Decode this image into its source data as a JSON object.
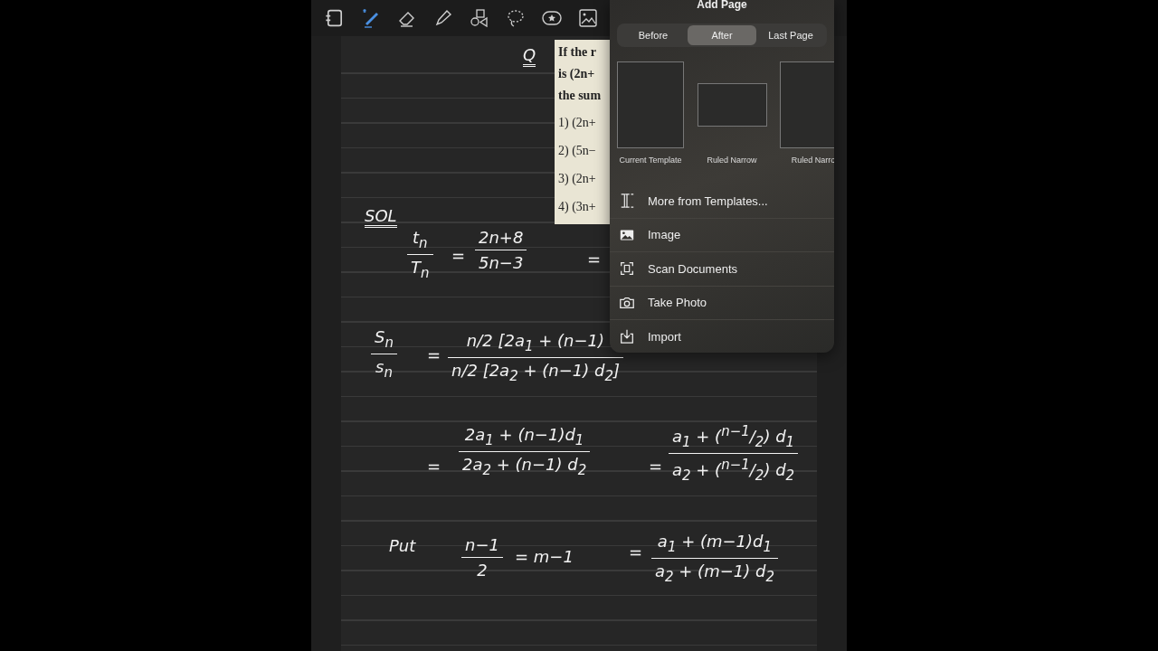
{
  "toolbar": {
    "tools": [
      {
        "kind": "pages",
        "selected": false
      },
      {
        "kind": "pen",
        "selected": true
      },
      {
        "kind": "eraser",
        "selected": false
      },
      {
        "kind": "highlighter",
        "selected": false
      },
      {
        "kind": "shapes",
        "selected": false
      },
      {
        "kind": "lasso",
        "selected": false
      },
      {
        "kind": "sticker",
        "selected": false
      },
      {
        "kind": "image",
        "selected": false
      }
    ]
  },
  "question_image": {
    "lines": [
      "If the r",
      "is (2n+",
      "the sum",
      "1) (2n+",
      "2) (5n−",
      "3) (2n+",
      "4) (3n+"
    ]
  },
  "ink": [
    {
      "kind": "underlined",
      "text": "Q"
    },
    {
      "kind": "underlined",
      "text": "SOL"
    },
    {
      "kind": "fraction",
      "num": "t$_{n}$",
      "den": "T$_{n}$"
    },
    {
      "kind": "label",
      "text": "="
    },
    {
      "kind": "fraction",
      "num": "2n+8",
      "den": "5n−3"
    },
    {
      "kind": "label",
      "text": "="
    },
    {
      "kind": "fraction",
      "num": "S$_{n}$",
      "den": "s$_{n}$"
    },
    {
      "kind": "label",
      "text": "="
    },
    {
      "kind": "fraction",
      "num": "n/2 [2a$_{1}$ + (n−1)",
      "den": "n/2 [2a$_{2}$ + (n−1) d$_{2}$]"
    },
    {
      "kind": "label",
      "text": "="
    },
    {
      "kind": "fraction",
      "num": "2a$_{1}$ + (n−1)d$_{1}$",
      "den": "2a$_{2}$ + (n−1) d$_{2}$"
    },
    {
      "kind": "label",
      "text": "="
    },
    {
      "kind": "fraction",
      "num": "a$_{1}$ + ($^{n−1}$/$_{2}$) d$_{1}$",
      "den": "a$_{2}$ + ($^{n−1}$/$_{2}$) d$_{2}$"
    },
    {
      "kind": "label",
      "text": "Put"
    },
    {
      "kind": "fraction",
      "num": "n−1",
      "den": "2"
    },
    {
      "kind": "label",
      "text": "= m−1"
    },
    {
      "kind": "label",
      "text": "="
    },
    {
      "kind": "fraction",
      "num": "a$_{1}$ + (m−1)d$_{1}$",
      "den": "a$_{2}$ + (m−1) d$_{2}$"
    }
  ],
  "popover": {
    "title": "Add Page",
    "segments": [
      {
        "label": "Before",
        "selected": false
      },
      {
        "label": "After",
        "selected": true
      },
      {
        "label": "Last Page",
        "selected": false
      }
    ],
    "templates": [
      {
        "label": "Current Template",
        "kind": "portrait"
      },
      {
        "label": "Ruled Narrow",
        "kind": "landscape"
      },
      {
        "label": "Ruled Narro",
        "kind": "portrait"
      }
    ],
    "actions": [
      {
        "label": "More from Templates...",
        "kind": "templates"
      },
      {
        "label": "Image",
        "kind": "image"
      },
      {
        "label": "Scan Documents",
        "kind": "scan"
      },
      {
        "label": "Take Photo",
        "kind": "camera"
      },
      {
        "label": "Import",
        "kind": "import"
      }
    ]
  }
}
